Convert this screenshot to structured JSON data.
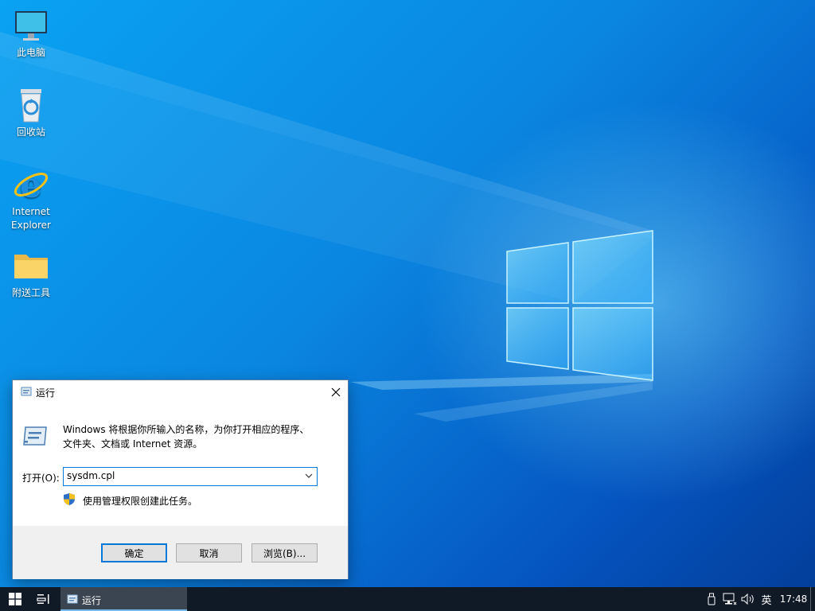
{
  "desktop": {
    "icons": [
      {
        "label": "此电脑",
        "icon": "this-pc-icon"
      },
      {
        "label": "回收站",
        "icon": "recycle-bin-icon"
      },
      {
        "label_line1": "Internet",
        "label_line2": "Explorer",
        "icon": "internet-explorer-icon"
      },
      {
        "label": "附送工具",
        "icon": "folder-icon"
      }
    ]
  },
  "run_dialog": {
    "title": "运行",
    "description_line1": "Windows 将根据你所输入的名称，为你打开相应的程序、",
    "description_line2": "文件夹、文档或 Internet 资源。",
    "open_label": "打开(O):",
    "open_value": "sysdm.cpl",
    "admin_note": "使用管理权限创建此任务。",
    "buttons": {
      "ok": "确定",
      "cancel": "取消",
      "browse": "浏览(B)..."
    }
  },
  "taskbar": {
    "active_app_label": "运行",
    "ime": "英",
    "clock": "17:48"
  },
  "colors": {
    "accent": "#0078d7",
    "taskbar": "#101a27",
    "active_task": "#3b4451"
  }
}
